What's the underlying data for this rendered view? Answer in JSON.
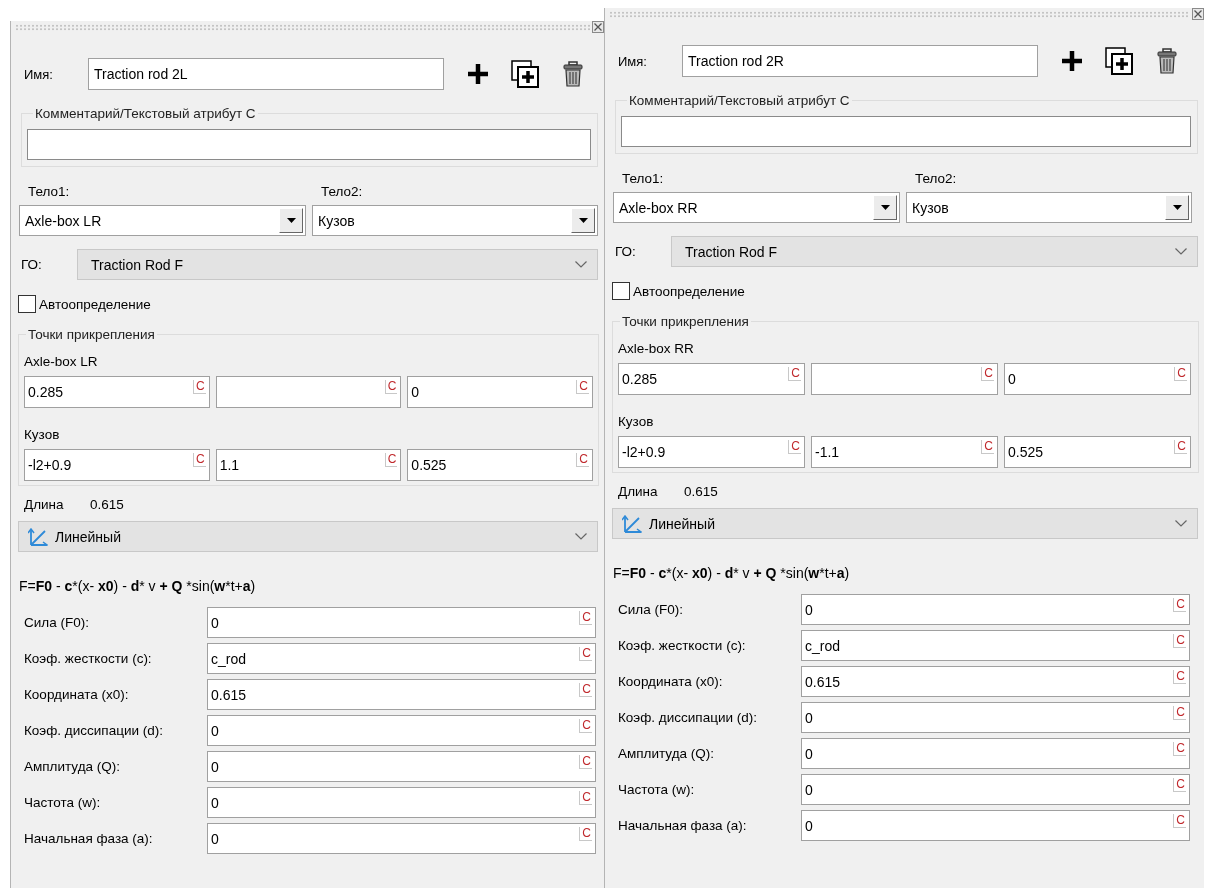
{
  "panels": [
    {
      "name": {
        "label": "Имя:",
        "value": "Traction rod 2L"
      },
      "comment": {
        "legend": "Комментарий/Текстовый атрибут C"
      },
      "body1": {
        "label": "Тело1:",
        "value": "Axle-box LR"
      },
      "body2": {
        "label": "Тело2:",
        "value": "Кузов"
      },
      "go": {
        "label": "ГО:",
        "value": "Traction Rod F"
      },
      "auto": {
        "label": "Автоопределение",
        "checked": false
      },
      "points": {
        "legend": "Точки прикрепления",
        "groups": [
          {
            "title": "Axle-box LR",
            "fields": [
              {
                "value": "0.285",
                "button": "C"
              },
              {
                "button": "C"
              },
              {
                "value": "0",
                "button": "C"
              }
            ]
          },
          {
            "title": "Кузов",
            "fields": [
              {
                "value": "-l2+0.9",
                "button": "C"
              },
              {
                "value": "1.1",
                "button": "C"
              },
              {
                "value": "0.525",
                "button": "C"
              }
            ]
          }
        ]
      },
      "length": {
        "label": "Длина",
        "value": "0.615"
      },
      "model": {
        "value": "Линейный"
      },
      "formula": [
        {
          "text": "F=",
          "bold": false
        },
        {
          "text": "F0",
          "bold": true
        },
        {
          "text": " - ",
          "bold": false
        },
        {
          "text": "c",
          "bold": true
        },
        {
          "text": "*(x- ",
          "bold": false
        },
        {
          "text": "x0",
          "bold": true
        },
        {
          "text": ") - ",
          "bold": false
        },
        {
          "text": "d",
          "bold": true
        },
        {
          "text": "* v ",
          "bold": false
        },
        {
          "text": "+ Q",
          "bold": true
        },
        {
          "text": " *sin(",
          "bold": false
        },
        {
          "text": "w",
          "bold": true
        },
        {
          "text": "*t+",
          "bold": false
        },
        {
          "text": "a",
          "bold": true
        },
        {
          "text": ")",
          "bold": false
        }
      ],
      "params": [
        {
          "label": "Сила (F0):",
          "value": "0",
          "button": "C"
        },
        {
          "label": "Коэф. жесткости (c):",
          "value": "c_rod",
          "button": "C"
        },
        {
          "label": "Координата (x0):",
          "value": "0.615",
          "button": "C"
        },
        {
          "label": "Коэф. диссипации (d):",
          "value": "0",
          "button": "C"
        },
        {
          "label": "Амплитуда (Q):",
          "value": "0",
          "button": "C"
        },
        {
          "label": "Частота (w):",
          "value": "0",
          "button": "C"
        },
        {
          "label": "Начальная фаза (a):",
          "value": "0",
          "button": "C"
        }
      ]
    },
    {
      "name": {
        "label": "Имя:",
        "value": "Traction rod 2R"
      },
      "comment": {
        "legend": "Комментарий/Текстовый атрибут C"
      },
      "body1": {
        "label": "Тело1:",
        "value": "Axle-box RR"
      },
      "body2": {
        "label": "Тело2:",
        "value": "Кузов"
      },
      "go": {
        "label": "ГО:",
        "value": "Traction Rod F"
      },
      "auto": {
        "label": "Автоопределение",
        "checked": false
      },
      "points": {
        "legend": "Точки прикрепления",
        "groups": [
          {
            "title": "Axle-box RR",
            "fields": [
              {
                "value": "0.285",
                "button": "C"
              },
              {
                "button": "C"
              },
              {
                "value": "0",
                "button": "C"
              }
            ]
          },
          {
            "title": "Кузов",
            "fields": [
              {
                "value": "-l2+0.9",
                "button": "C"
              },
              {
                "value": "-1.1",
                "button": "C"
              },
              {
                "value": "0.525",
                "button": "C"
              }
            ]
          }
        ]
      },
      "length": {
        "label": "Длина",
        "value": "0.615"
      },
      "model": {
        "value": "Линейный"
      },
      "formula": [
        {
          "text": "F=",
          "bold": false
        },
        {
          "text": "F0",
          "bold": true
        },
        {
          "text": " - ",
          "bold": false
        },
        {
          "text": "c",
          "bold": true
        },
        {
          "text": "*(x- ",
          "bold": false
        },
        {
          "text": "x0",
          "bold": true
        },
        {
          "text": ") - ",
          "bold": false
        },
        {
          "text": "d",
          "bold": true
        },
        {
          "text": "* v ",
          "bold": false
        },
        {
          "text": "+ Q",
          "bold": true
        },
        {
          "text": " *sin(",
          "bold": false
        },
        {
          "text": "w",
          "bold": true
        },
        {
          "text": "*t+",
          "bold": false
        },
        {
          "text": "a",
          "bold": true
        },
        {
          "text": ")",
          "bold": false
        }
      ],
      "params": [
        {
          "label": "Сила (F0):",
          "value": "0",
          "button": "C"
        },
        {
          "label": "Коэф. жесткости (c):",
          "value": "c_rod",
          "button": "C"
        },
        {
          "label": "Координата (x0):",
          "value": "0.615",
          "button": "C"
        },
        {
          "label": "Коэф. диссипации (d):",
          "value": "0",
          "button": "C"
        },
        {
          "label": "Амплитуда (Q):",
          "value": "0",
          "button": "C"
        },
        {
          "label": "Частота (w):",
          "value": "0",
          "button": "C"
        },
        {
          "label": "Начальная фаза (a):",
          "value": "0",
          "button": "C"
        }
      ]
    }
  ]
}
